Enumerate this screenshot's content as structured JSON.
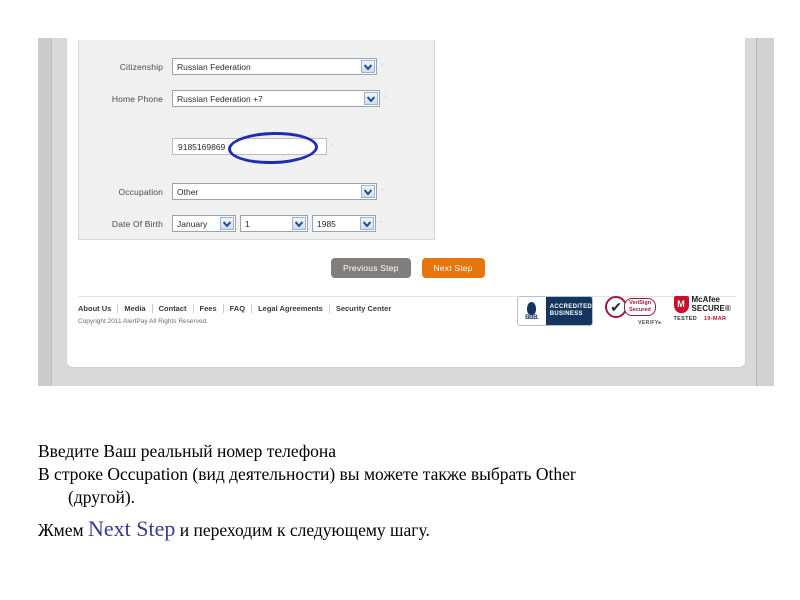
{
  "screenshot": {
    "form": {
      "fields": [
        {
          "label": "Citizenship",
          "type": "select",
          "value": "Russian Federation",
          "required_mark": "*"
        },
        {
          "label": "Home Phone",
          "type": "select",
          "value": "Russian Federation +7",
          "required_mark": "*"
        },
        {
          "label": "",
          "type": "text",
          "value": "9185169869",
          "required_mark": "*"
        },
        {
          "label": "Occupation",
          "type": "select",
          "value": "Other",
          "required_mark": "*"
        },
        {
          "label": "Date Of Birth",
          "type": "dob",
          "required_mark": "*",
          "month": "January",
          "day": "1",
          "year": "1985"
        }
      ]
    },
    "buttons": {
      "previous": "Previous Step",
      "next": "Next Step"
    },
    "footer": {
      "links": [
        "About Us",
        "Media",
        "Contact",
        "Fees",
        "FAQ",
        "Legal Agreements",
        "Security Center"
      ],
      "copyright": "Copyright 2011 AlertPay All Rights Reserved.",
      "badges": {
        "bbb": {
          "mark": "BBB.",
          "line1": "ACCREDITED",
          "line2": "BUSINESS"
        },
        "verisign": {
          "check": "✔",
          "line1": "VeriSign",
          "line2": "Secured",
          "verify": "VERIFY▸"
        },
        "mcafee": {
          "mark": "M",
          "line1": "McAfee",
          "line2": "SECURE®",
          "tested": "TESTED",
          "date": "19-MAR"
        }
      }
    }
  },
  "caption": {
    "line1": "Введите Ваш реальный номер телефона",
    "line2": "В строке Occupation (вид деятельности) вы можете также выбрать Other",
    "line2b": "(другой).",
    "line3_pre": "Жмем ",
    "line3_accent": "Next Step",
    "line3_post": " и переходим к следующему шагу."
  },
  "colors": {
    "next_button": "#e8740c",
    "prev_button": "#807f7d",
    "highlight_ellipse": "#1f2bb5",
    "accent_text": "#3b3b8f"
  }
}
